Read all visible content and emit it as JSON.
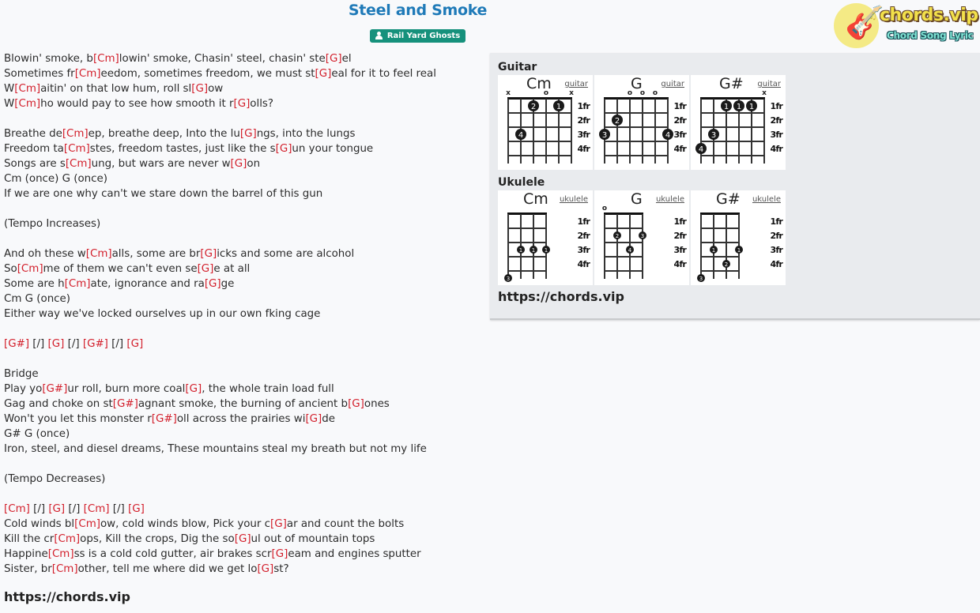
{
  "song": {
    "title": "Steel and Smoke",
    "artist": "Rail Yard Ghosts",
    "artist_icon": "person-icon"
  },
  "logo": {
    "text": "chords.vip",
    "tagline": "Chord Song Lyric",
    "icon": "guitar-icon"
  },
  "colors": {
    "title": "#1f7ab8",
    "artist_badge": "#16917c",
    "chord": "#d3202c",
    "panel_bg": "#e9ebee"
  },
  "lyrics": [
    [
      [
        "t",
        "Blowin' smoke, b"
      ],
      [
        "c",
        "[Cm]"
      ],
      [
        "t",
        "lowin' smoke, Chasin' steel, chasin' ste"
      ],
      [
        "c",
        "[G]"
      ],
      [
        "t",
        "el"
      ]
    ],
    [
      [
        "t",
        "Sometimes fr"
      ],
      [
        "c",
        "[Cm]"
      ],
      [
        "t",
        "eedom, sometimes freedom, we must st"
      ],
      [
        "c",
        "[G]"
      ],
      [
        "t",
        "eal for it to feel real"
      ]
    ],
    [
      [
        "t",
        "W"
      ],
      [
        "c",
        "[Cm]"
      ],
      [
        "t",
        "aitin' on that low hum, roll sl"
      ],
      [
        "c",
        "[G]"
      ],
      [
        "t",
        "ow"
      ]
    ],
    [
      [
        "t",
        "W"
      ],
      [
        "c",
        "[Cm]"
      ],
      [
        "t",
        "ho would pay to see how smooth it r"
      ],
      [
        "c",
        "[G]"
      ],
      [
        "t",
        "olls?"
      ]
    ],
    [],
    [
      [
        "t",
        "Breathe de"
      ],
      [
        "c",
        "[Cm]"
      ],
      [
        "t",
        "ep, breathe deep, Into the lu"
      ],
      [
        "c",
        "[G]"
      ],
      [
        "t",
        "ngs, into the lungs"
      ]
    ],
    [
      [
        "t",
        "Freedom ta"
      ],
      [
        "c",
        "[Cm]"
      ],
      [
        "t",
        "stes, freedom tastes, just like the s"
      ],
      [
        "c",
        "[G]"
      ],
      [
        "t",
        "un your tongue"
      ]
    ],
    [
      [
        "t",
        "Songs are s"
      ],
      [
        "c",
        "[Cm]"
      ],
      [
        "t",
        "ung, but wars are never w"
      ],
      [
        "c",
        "[G]"
      ],
      [
        "t",
        "on"
      ]
    ],
    [
      [
        "t",
        "Cm (once) G (once)"
      ]
    ],
    [
      [
        "t",
        "If we are one why can't we stare down the barrel of this gun"
      ]
    ],
    [],
    [
      [
        "t",
        "(Tempo Increases)"
      ]
    ],
    [],
    [
      [
        "t",
        "And oh these w"
      ],
      [
        "c",
        "[Cm]"
      ],
      [
        "t",
        "alls, some are br"
      ],
      [
        "c",
        "[G]"
      ],
      [
        "t",
        "icks and some are alcohol"
      ]
    ],
    [
      [
        "t",
        "So"
      ],
      [
        "c",
        "[Cm]"
      ],
      [
        "t",
        "me of them we can't even se"
      ],
      [
        "c",
        "[G]"
      ],
      [
        "t",
        "e at all"
      ]
    ],
    [
      [
        "t",
        "Some are h"
      ],
      [
        "c",
        "[Cm]"
      ],
      [
        "t",
        "ate, ignorance and ra"
      ],
      [
        "c",
        "[G]"
      ],
      [
        "t",
        "ge"
      ]
    ],
    [
      [
        "t",
        "Cm G (once)"
      ]
    ],
    [
      [
        "t",
        "Either way we've locked ourselves up in our own fking cage"
      ]
    ],
    [],
    [
      [
        "c",
        "[G#]"
      ],
      [
        "t",
        " [/] "
      ],
      [
        "c",
        "[G]"
      ],
      [
        "t",
        " [/] "
      ],
      [
        "c",
        "[G#]"
      ],
      [
        "t",
        " [/] "
      ],
      [
        "c",
        "[G]"
      ]
    ],
    [],
    [
      [
        "t",
        "Bridge"
      ]
    ],
    [
      [
        "t",
        "Play yo"
      ],
      [
        "c",
        "[G#]"
      ],
      [
        "t",
        "ur roll, burn more coal"
      ],
      [
        "c",
        "[G]"
      ],
      [
        "t",
        ", the whole train load full"
      ]
    ],
    [
      [
        "t",
        "Gag and choke on st"
      ],
      [
        "c",
        "[G#]"
      ],
      [
        "t",
        "agnant smoke, the burning of ancient b"
      ],
      [
        "c",
        "[G]"
      ],
      [
        "t",
        "ones"
      ]
    ],
    [
      [
        "t",
        "Won't you let this monster r"
      ],
      [
        "c",
        "[G#]"
      ],
      [
        "t",
        "oll across the prairies wi"
      ],
      [
        "c",
        "[G]"
      ],
      [
        "t",
        "de"
      ]
    ],
    [
      [
        "t",
        "G# G (once)"
      ]
    ],
    [
      [
        "t",
        "Iron, steel, and diesel dreams, These mountains steal my breath but not my life"
      ]
    ],
    [],
    [
      [
        "t",
        "(Tempo Decreases)"
      ]
    ],
    [],
    [
      [
        "c",
        "[Cm]"
      ],
      [
        "t",
        " [/] "
      ],
      [
        "c",
        "[G]"
      ],
      [
        "t",
        " [/] "
      ],
      [
        "c",
        "[Cm]"
      ],
      [
        "t",
        " [/] "
      ],
      [
        "c",
        "[G]"
      ]
    ],
    [
      [
        "t",
        "Cold winds bl"
      ],
      [
        "c",
        "[Cm]"
      ],
      [
        "t",
        "ow, cold winds blow, Pick your c"
      ],
      [
        "c",
        "[G]"
      ],
      [
        "t",
        "ar and count the bolts"
      ]
    ],
    [
      [
        "t",
        "Kill the cr"
      ],
      [
        "c",
        "[Cm]"
      ],
      [
        "t",
        "ops, Kill the crops, Dig the so"
      ],
      [
        "c",
        "[G]"
      ],
      [
        "t",
        "ul out of mountain tops"
      ]
    ],
    [
      [
        "t",
        "Happine"
      ],
      [
        "c",
        "[Cm]"
      ],
      [
        "t",
        "ss is a cold cold gutter, air brakes scr"
      ],
      [
        "c",
        "[G]"
      ],
      [
        "t",
        "eam and engines sputter"
      ]
    ],
    [
      [
        "t",
        "Sister, br"
      ],
      [
        "c",
        "[Cm]"
      ],
      [
        "t",
        "other, tell me where did we get lo"
      ],
      [
        "c",
        "[G]"
      ],
      [
        "t",
        "st?"
      ]
    ]
  ],
  "footer_url": "https://chords.vip",
  "chord_panel": {
    "guitar_label": "Guitar",
    "ukulele_label": "Ukulele",
    "url": "https://chords.vip",
    "fret_labels": [
      "1fr",
      "2fr",
      "3fr",
      "4fr"
    ],
    "guitar": [
      {
        "name": "Cm",
        "link": "guitar",
        "markers": [
          "x",
          "",
          "",
          "o",
          "",
          "x"
        ],
        "dots": [
          {
            "string": 3,
            "fret": 1,
            "finger": "2"
          },
          {
            "string": 5,
            "fret": 1,
            "finger": "1"
          },
          {
            "string": 2,
            "fret": 3,
            "finger": "4"
          }
        ]
      },
      {
        "name": "G",
        "link": "guitar",
        "markers": [
          "",
          "",
          "o",
          "o",
          "o",
          ""
        ],
        "dots": [
          {
            "string": 2,
            "fret": 2,
            "finger": "2"
          },
          {
            "string": 1,
            "fret": 3,
            "finger": "3"
          },
          {
            "string": 6,
            "fret": 3,
            "finger": "4"
          }
        ]
      },
      {
        "name": "G#",
        "link": "guitar",
        "markers": [
          "",
          "",
          "",
          "",
          "",
          "x"
        ],
        "dots": [
          {
            "string": 3,
            "fret": 1,
            "finger": "1"
          },
          {
            "string": 4,
            "fret": 1,
            "finger": "1"
          },
          {
            "string": 5,
            "fret": 1,
            "finger": "1"
          },
          {
            "string": 2,
            "fret": 3,
            "finger": "3"
          },
          {
            "string": 1,
            "fret": 4,
            "finger": "4"
          }
        ]
      }
    ],
    "ukulele": [
      {
        "name": "Cm",
        "link": "ukulele",
        "markers": [
          "",
          "",
          "",
          ""
        ],
        "dots": [
          {
            "string": 2,
            "fret": 3,
            "finger": "1"
          },
          {
            "string": 3,
            "fret": 3,
            "finger": "1"
          },
          {
            "string": 4,
            "fret": 3,
            "finger": "1"
          },
          {
            "string": 1,
            "fret": 5,
            "finger": "3"
          }
        ]
      },
      {
        "name": "G",
        "link": "ukulele",
        "markers": [
          "o",
          "",
          "",
          ""
        ],
        "dots": [
          {
            "string": 2,
            "fret": 2,
            "finger": "2"
          },
          {
            "string": 4,
            "fret": 2,
            "finger": "3"
          },
          {
            "string": 3,
            "fret": 3,
            "finger": "4"
          }
        ]
      },
      {
        "name": "G#",
        "link": "ukulele",
        "markers": [
          "",
          "",
          "",
          ""
        ],
        "dots": [
          {
            "string": 2,
            "fret": 3,
            "finger": "1"
          },
          {
            "string": 4,
            "fret": 3,
            "finger": "1"
          },
          {
            "string": 3,
            "fret": 4,
            "finger": "2"
          },
          {
            "string": 1,
            "fret": 5,
            "finger": "3"
          }
        ]
      }
    ]
  }
}
